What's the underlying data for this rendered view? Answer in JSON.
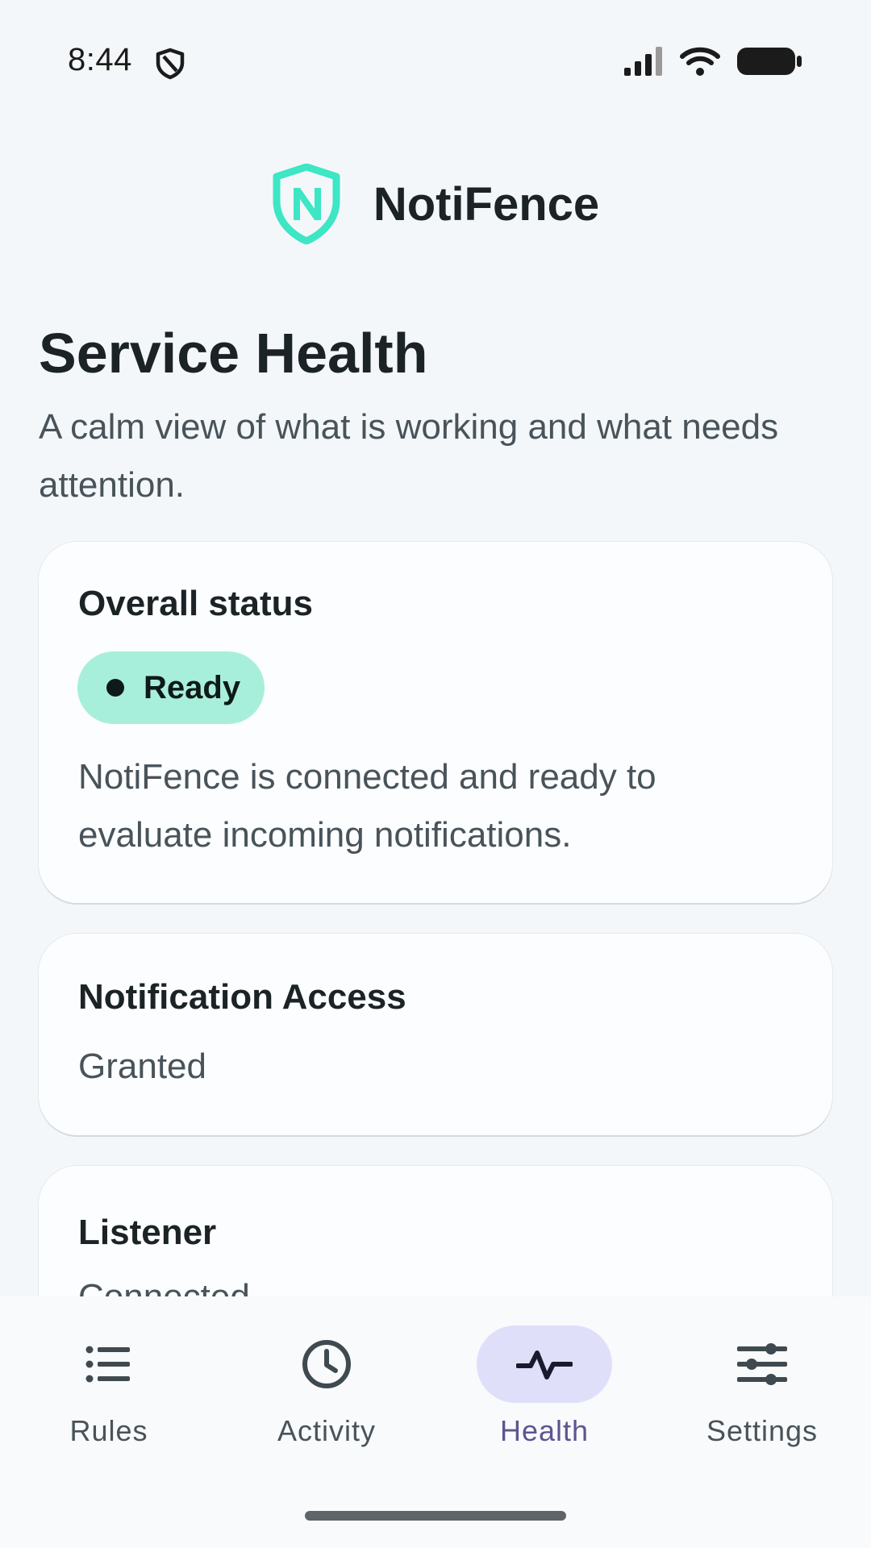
{
  "status_bar": {
    "time": "8:44",
    "shield_icon": "shield-icon",
    "signal_icon": "signal-icon",
    "wifi_icon": "wifi-icon",
    "battery_icon": "battery-icon"
  },
  "app": {
    "name": "NotiFence",
    "logo_icon": "shield-n-logo",
    "accent_color": "#3DE6C4"
  },
  "page": {
    "title": "Service Health",
    "subtitle": "A calm view of what is working and what needs attention."
  },
  "cards": {
    "overall": {
      "title": "Overall status",
      "badge": "Ready",
      "badge_color": "#A8EFDB",
      "description": "NotiFence is connected and ready to evaluate incoming notifications."
    },
    "access": {
      "title": "Notification Access",
      "value": "Granted"
    },
    "listener": {
      "title": "Listener",
      "value": "Connected"
    }
  },
  "nav": {
    "items": [
      {
        "label": "Rules",
        "icon": "list-icon",
        "active": false
      },
      {
        "label": "Activity",
        "icon": "clock-icon",
        "active": false
      },
      {
        "label": "Health",
        "icon": "pulse-icon",
        "active": true
      },
      {
        "label": "Settings",
        "icon": "sliders-icon",
        "active": false
      }
    ],
    "active_color": "#E0DFFA"
  }
}
